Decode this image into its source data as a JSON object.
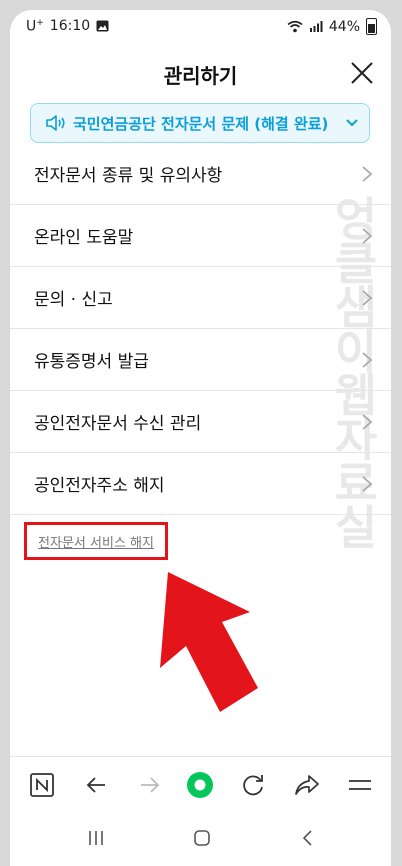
{
  "status_bar": {
    "carrier": "U",
    "carrier_sup": "+",
    "time": "16:10",
    "battery": "44%"
  },
  "header": {
    "title": "관리하기"
  },
  "notice": {
    "text": "국민연금공단 전자문서 문제 (해결 완료)"
  },
  "menu": {
    "items": [
      {
        "label": "전자문서 종류 및 유의사항"
      },
      {
        "label": "온라인 도움말"
      },
      {
        "label": "문의 · 신고"
      },
      {
        "label": "유통증명서 발급"
      },
      {
        "label": "공인전자문서 수신 관리"
      },
      {
        "label": "공인전자주소 해지"
      }
    ]
  },
  "terminate_link": {
    "label": "전자문서 서비스 해지"
  },
  "watermark": "엉클샘이웹자료실",
  "colors": {
    "accent": "#0a9fd8",
    "highlight_red": "#e4141b",
    "naver_green": "#03c75a"
  }
}
